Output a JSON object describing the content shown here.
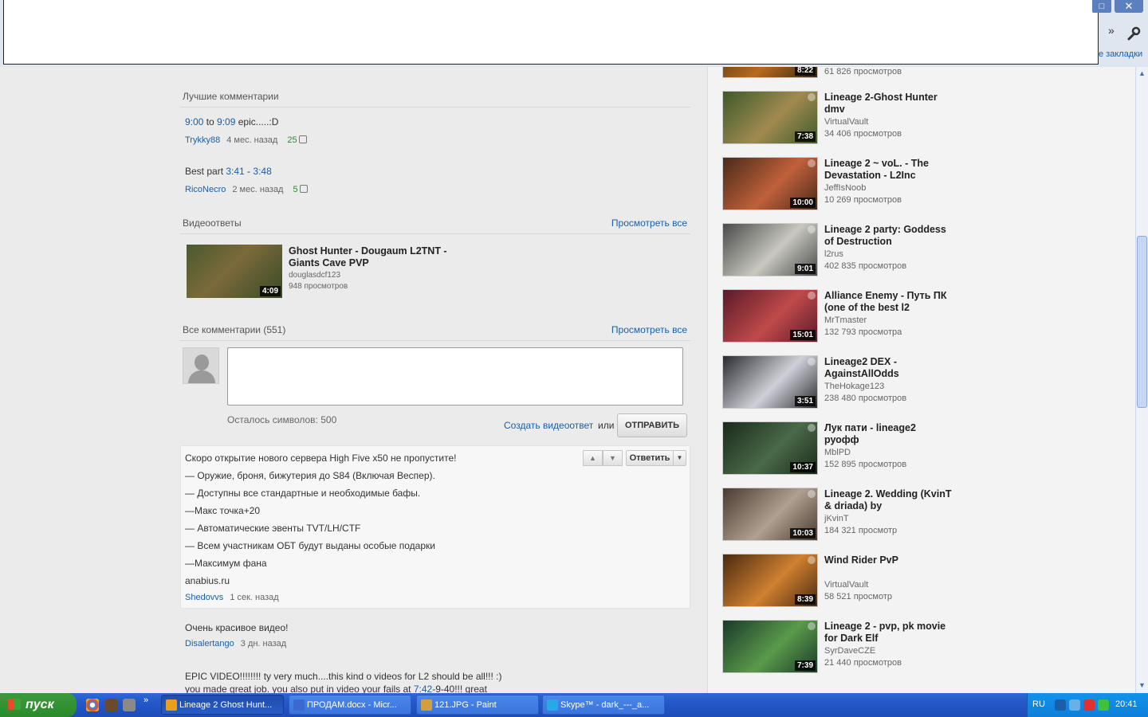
{
  "chrome": {
    "restore_icon": "□",
    "close_icon": "✕",
    "more_chevron": "»",
    "bookmarks_label": "е закладки"
  },
  "top_comments": {
    "title": "Лучшие комментарии",
    "items": [
      {
        "parts": [
          {
            "text": "9:00",
            "link": true
          },
          {
            "text": " to ",
            "link": false
          },
          {
            "text": "9:09",
            "link": true
          },
          {
            "text": " epic.....:D",
            "link": false
          }
        ],
        "user": "Trykky88",
        "time": "4 мес. назад",
        "likes": "25"
      },
      {
        "parts": [
          {
            "text": "Best part ",
            "link": false
          },
          {
            "text": "3:41",
            "link": true
          },
          {
            "text": " - ",
            "link": false
          },
          {
            "text": "3:48",
            "link": true
          }
        ],
        "user": "RicoNecro",
        "time": "2 мес. назад",
        "likes": "5"
      }
    ]
  },
  "video_responses": {
    "title": "Видеоответы",
    "view_all": "Просмотреть все",
    "item": {
      "title": "Ghost Hunter - Dougaum L2TNT - Giants Cave PVP",
      "duration": "4:09",
      "user": "douglasdcf123",
      "views": "948 просмотров"
    }
  },
  "all_comments": {
    "title": "Все комментарии (551)",
    "view_all": "Просмотреть все",
    "chars_left": "Осталось символов: 500",
    "create_video_reply": "Создать видеоответ",
    "or": "или",
    "send": "ОТПРАВИТЬ"
  },
  "highlighted_comment": {
    "lines": [
      "Скоро открытие нового сервера High Five x50 не пропустите!",
      "— Оружие, броня, бижутерия до S84 (Включая Веспер).",
      "— Доступны все стандартные и необходимые бафы.",
      "—Макс точка+20",
      "— Автоматические эвенты TVT/LH/CTF",
      "— Всем участникам ОБТ будут выданы особые подарки",
      "—Максимум фана",
      "anabius.ru"
    ],
    "user": "Shedovvs",
    "time": "1 сек. назад",
    "reply": "Ответить",
    "reply_menu_icon": "▼",
    "like_icon": "▲",
    "dislike_icon": "▼"
  },
  "more_comments": [
    {
      "text": "Очень красивое видео!",
      "user": "Disalertango",
      "time": "3 дн. назад"
    },
    {
      "text": "EPIC VIDEO!!!!!!!! ty very much....this kind o videos for L2 should be all!!! :)",
      "text2_before": "you made great job. you also put in video your fails at ",
      "text2_link": "7:42",
      "text2_after": "-9-40!!! great"
    }
  ],
  "related": [
    {
      "title": "",
      "user": "",
      "views": "61 826 просмотров",
      "duration": "8:22",
      "colors": [
        "#3a2a10",
        "#b86a20"
      ]
    },
    {
      "title": "Lineage 2-Ghost Hunter dmv",
      "user": "VirtualVault",
      "views": "34 406 просмотров",
      "duration": "7:38",
      "colors": [
        "#3e5a2a",
        "#a08a50"
      ]
    },
    {
      "title": "Lineage 2 ~ voL. - The Devastation - L2Inc",
      "user": "JeffIsNoob",
      "views": "10 269 просмотров",
      "duration": "10:00",
      "colors": [
        "#4a2a1a",
        "#c0603a"
      ]
    },
    {
      "title": "Lineage 2 party: Goddess of Destruction",
      "user": "l2rus",
      "views": "402 835 просмотров",
      "duration": "9:01",
      "colors": [
        "#4a4a4a",
        "#c8c8c0"
      ]
    },
    {
      "title": "Alliance Enemy - Путь ПК (one of the best l2",
      "user": "MrTmaster",
      "views": "132 793 просмотра",
      "duration": "15:01",
      "colors": [
        "#5a1a2a",
        "#c04a4a"
      ]
    },
    {
      "title": "Lineage2 DEX - AgainstAllOdds",
      "user": "TheHokage123",
      "views": "238 480 просмотров",
      "duration": "3:51",
      "colors": [
        "#2a2a30",
        "#d0d0d8"
      ]
    },
    {
      "title": "Лук пати - lineage2 руофф",
      "user": "MblPD",
      "views": "152 895 просмотров",
      "duration": "10:37",
      "colors": [
        "#1a2a1a",
        "#4a6a4a"
      ]
    },
    {
      "title": "Lineage 2. Wedding (KvinT & driada) by",
      "user": "jKvinT",
      "views": "184 321 просмотр",
      "duration": "10:03",
      "colors": [
        "#4a3a30",
        "#b0a090"
      ]
    },
    {
      "title": "Wind Rider PvP",
      "user": "VirtualVault",
      "views": "58 521 просмотр",
      "duration": "8:39",
      "colors": [
        "#4a2a10",
        "#d08030"
      ]
    },
    {
      "title": "Lineage 2 - pvp, pk movie for Dark Elf",
      "user": "SyrDaveCZE",
      "views": "21 440 просмотров",
      "duration": "7:39",
      "colors": [
        "#1a3a2a",
        "#5a9a4a"
      ]
    }
  ],
  "scrollbar": {
    "up_icon": "▲",
    "down_icon": "▼"
  },
  "taskbar": {
    "start": "пуск",
    "more": "»",
    "tasks": [
      {
        "label": "Lineage 2 Ghost Hunt...",
        "active": true,
        "icon_color": "#e8a020"
      },
      {
        "label": "ПРОДАМ.docx - Micr...",
        "active": false,
        "icon_color": "#3a6ad0"
      },
      {
        "label": "121.JPG - Paint",
        "active": false,
        "icon_color": "#d0a040"
      },
      {
        "label": "Skype™ - dark_---_a...",
        "active": false,
        "icon_color": "#28a8e8"
      }
    ],
    "lang": "RU",
    "clock": "20:41"
  }
}
